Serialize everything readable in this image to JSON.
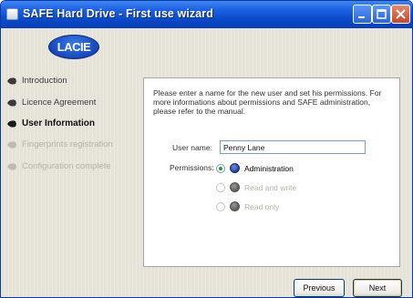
{
  "window": {
    "title": "SAFE Hard Drive - First use wizard"
  },
  "brand": {
    "logo_text": "LACIE"
  },
  "steps": [
    {
      "label": "Introduction",
      "state": "done"
    },
    {
      "label": "Licence Agreement",
      "state": "done"
    },
    {
      "label": "User Information",
      "state": "active"
    },
    {
      "label": "Fingerprints registration",
      "state": "disabled"
    },
    {
      "label": "Configuration complete",
      "state": "disabled"
    }
  ],
  "panel": {
    "description": "Please enter a name for the new user and set his permissions. For more informations about permissions and SAFE administration, please refer to the manual.",
    "username_label": "User name:",
    "username_value": "Penny Lane",
    "permissions_label": "Permissions:",
    "permissions": [
      {
        "label": "Administration",
        "selected": true,
        "enabled": true,
        "icon": "admin-icon"
      },
      {
        "label": "Read and write",
        "selected": false,
        "enabled": false,
        "icon": "read-write-icon"
      },
      {
        "label": "Read only",
        "selected": false,
        "enabled": false,
        "icon": "read-only-icon"
      }
    ]
  },
  "buttons": {
    "previous": "Previous",
    "next": "Next"
  },
  "colors": {
    "titlebar": "#0a49c8",
    "accent": "#2a9a2a"
  }
}
